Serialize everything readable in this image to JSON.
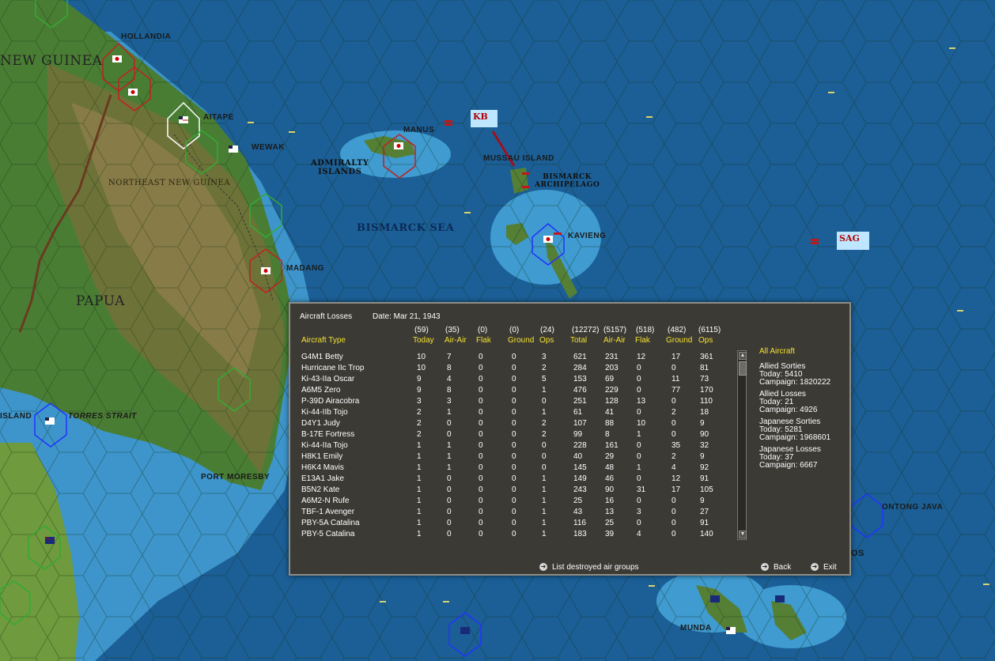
{
  "map": {
    "labels": {
      "hollandia": "HOLLANDIA",
      "new_guinea": "NEW GUINEA",
      "aitape": "AITAPE",
      "wewak": "WEWAK",
      "manus": "MANUS",
      "admiralty": "ADMIRALTY",
      "islands": "ISLANDS",
      "mussau": "MUSSAU ISLAND",
      "bismarck_a1": "BISMARCK",
      "bismarck_a2": "ARCHIPELAGO",
      "ne_new_guinea": "NORTHEAST NEW GUINEA",
      "bismarck_sea": "BISMARCK SEA",
      "kavieng": "KAVIENG",
      "madang": "MADANG",
      "papua": "PAPUA",
      "island": "ISLAND",
      "torres": "TORRES STRAIT",
      "port_moresby": "PORT MORESBY",
      "ontong_java": "ONTONG JAVA",
      "munda": "MUNDA",
      "partial_os": "OS"
    },
    "taskforces": {
      "kb": "KB",
      "sag": "SAG"
    }
  },
  "dialog": {
    "title": "Aircraft Losses",
    "date": "Date: Mar 21, 1943",
    "totals_row": {
      "today": "(59)",
      "air_air": "(35)",
      "flak": "(0)",
      "ground": "(0)",
      "ops": "(24)",
      "total": "(12272)",
      "c_air_air": "(5157)",
      "c_flak": "(518)",
      "c_ground": "(482)",
      "c_ops": "(6115)"
    },
    "columns": {
      "type": "Aircraft Type",
      "today": "Today",
      "air_air": "Air-Air",
      "flak": "Flak",
      "ground": "Ground",
      "ops": "Ops",
      "total": "Total",
      "c_air_air": "Air-Air",
      "c_flak": "Flak",
      "c_ground": "Ground",
      "c_ops": "Ops"
    },
    "rows": [
      [
        "G4M1 Betty",
        "10",
        "7",
        "0",
        "0",
        "3",
        "621",
        "231",
        "12",
        "17",
        "361"
      ],
      [
        "Hurricane IIc Trop",
        "10",
        "8",
        "0",
        "0",
        "2",
        "284",
        "203",
        "0",
        "0",
        "81"
      ],
      [
        "Ki-43-IIa Oscar",
        "9",
        "4",
        "0",
        "0",
        "5",
        "153",
        "69",
        "0",
        "11",
        "73"
      ],
      [
        "A6M5 Zero",
        "9",
        "8",
        "0",
        "0",
        "1",
        "476",
        "229",
        "0",
        "77",
        "170"
      ],
      [
        "P-39D Airacobra",
        "3",
        "3",
        "0",
        "0",
        "0",
        "251",
        "128",
        "13",
        "0",
        "110"
      ],
      [
        "Ki-44-IIb Tojo",
        "2",
        "1",
        "0",
        "0",
        "1",
        "61",
        "41",
        "0",
        "2",
        "18"
      ],
      [
        "D4Y1 Judy",
        "2",
        "0",
        "0",
        "0",
        "2",
        "107",
        "88",
        "10",
        "0",
        "9"
      ],
      [
        "B-17E Fortress",
        "2",
        "0",
        "0",
        "0",
        "2",
        "99",
        "8",
        "1",
        "0",
        "90"
      ],
      [
        "Ki-44-IIa Tojo",
        "1",
        "1",
        "0",
        "0",
        "0",
        "228",
        "161",
        "0",
        "35",
        "32"
      ],
      [
        "H8K1 Emily",
        "1",
        "1",
        "0",
        "0",
        "0",
        "40",
        "29",
        "0",
        "2",
        "9"
      ],
      [
        "H6K4 Mavis",
        "1",
        "1",
        "0",
        "0",
        "0",
        "145",
        "48",
        "1",
        "4",
        "92"
      ],
      [
        "E13A1 Jake",
        "1",
        "0",
        "0",
        "0",
        "1",
        "149",
        "46",
        "0",
        "12",
        "91"
      ],
      [
        "B5N2 Kate",
        "1",
        "0",
        "0",
        "0",
        "1",
        "243",
        "90",
        "31",
        "17",
        "105"
      ],
      [
        "A6M2-N Rufe",
        "1",
        "0",
        "0",
        "0",
        "1",
        "25",
        "16",
        "0",
        "0",
        "9"
      ],
      [
        "TBF-1 Avenger",
        "1",
        "0",
        "0",
        "0",
        "1",
        "43",
        "13",
        "3",
        "0",
        "27"
      ],
      [
        "PBY-5A Catalina",
        "1",
        "0",
        "0",
        "0",
        "1",
        "116",
        "25",
        "0",
        "0",
        "91"
      ],
      [
        "PBY-5 Catalina",
        "1",
        "0",
        "0",
        "0",
        "1",
        "183",
        "39",
        "4",
        "0",
        "140"
      ]
    ],
    "side": {
      "all_aircraft": "All Aircraft",
      "allied_sorties": {
        "label": "Allied Sorties",
        "today": "Today:  5410",
        "campaign": "Campaign: 1820222"
      },
      "allied_losses": {
        "label": "Allied Losses",
        "today": "Today:  21",
        "campaign": "Campaign: 4926"
      },
      "japanese_sorties": {
        "label": "Japanese Sorties",
        "today": "Today:  5281",
        "campaign": "Campaign: 1968601"
      },
      "japanese_losses": {
        "label": "Japanese Losses",
        "today": "Today:  37",
        "campaign": "Campaign: 6667"
      }
    },
    "buttons": {
      "list_destroyed": "List destroyed air groups",
      "back": "Back",
      "exit": "Exit"
    }
  },
  "colors": {
    "accent_yellow": "#f3e230",
    "panel_bg": "#3c3a35",
    "sea": "#1b5f96",
    "land": "#3f7a33"
  }
}
